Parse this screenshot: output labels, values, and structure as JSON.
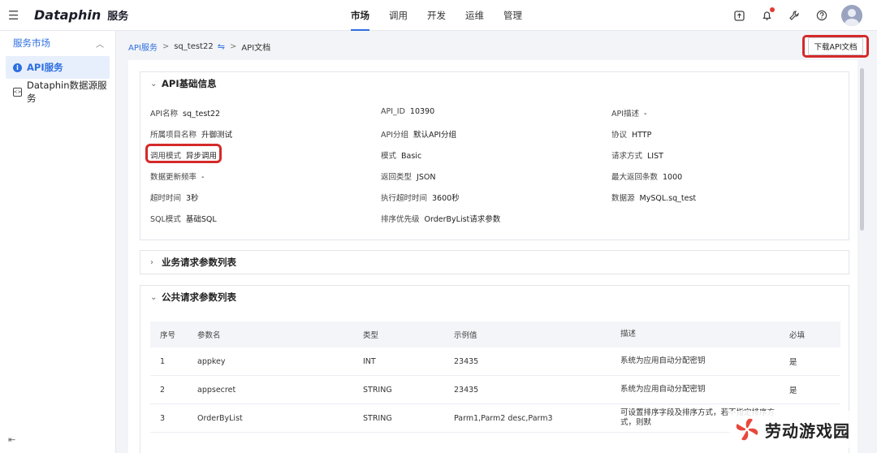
{
  "header": {
    "brand": "Dataphin",
    "brand_suffix": "服务",
    "nav_tabs": [
      {
        "label": "市场",
        "active": true
      },
      {
        "label": "调用",
        "active": false
      },
      {
        "label": "开发",
        "active": false
      },
      {
        "label": "运维",
        "active": false
      },
      {
        "label": "管理",
        "active": false
      }
    ],
    "accent_color": "#2d6fe0"
  },
  "sidebar": {
    "group_label": "服务市场",
    "items": [
      {
        "label": "API服务",
        "active": true,
        "icon": "info-icon"
      },
      {
        "label": "Dataphin数据源服务",
        "active": false,
        "icon": "datasource-icon"
      }
    ]
  },
  "breadcrumb": {
    "root": "API服务",
    "api": "sq_test22",
    "current": "API文档"
  },
  "actions": {
    "download_label": "下载API文档"
  },
  "basic_info": {
    "title": "API基础信息",
    "fields": [
      {
        "key": "API名称",
        "value": "sq_test22"
      },
      {
        "key": "API_ID",
        "value": "10390"
      },
      {
        "key": "API描述",
        "value": "-"
      },
      {
        "key": "所属项目名称",
        "value": "升御测试"
      },
      {
        "key": "API分组",
        "value": "默认API分组"
      },
      {
        "key": "协议",
        "value": "HTTP"
      },
      {
        "key": "调用模式",
        "value": "异步调用"
      },
      {
        "key": "模式",
        "value": "Basic"
      },
      {
        "key": "请求方式",
        "value": "LIST"
      },
      {
        "key": "数据更新频率",
        "value": "-"
      },
      {
        "key": "返回类型",
        "value": "JSON"
      },
      {
        "key": "最大返回条数",
        "value": "1000"
      },
      {
        "key": "超时时间",
        "value": "3秒"
      },
      {
        "key": "执行超时时间",
        "value": "3600秒"
      },
      {
        "key": "数据源",
        "value": "MySQL.sq_test"
      },
      {
        "key": "SQL模式",
        "value": "基础SQL"
      },
      {
        "key": "排序优先级",
        "value": "OrderByList请求参数"
      }
    ]
  },
  "business_params": {
    "title": "业务请求参数列表"
  },
  "public_params": {
    "title": "公共请求参数列表",
    "columns": [
      "序号",
      "参数名",
      "类型",
      "示例值",
      "描述",
      "必填"
    ],
    "rows": [
      [
        "1",
        "appkey",
        "INT",
        "23435",
        "系统为应用自动分配密钥",
        "是"
      ],
      [
        "2",
        "appsecret",
        "STRING",
        "23435",
        "系统为应用自动分配密钥",
        "是"
      ],
      [
        "3",
        "OrderByList",
        "STRING",
        "Parm1,Parm2 desc,Parm3",
        "可设置排序字段及排序方式，若不指定排序方式，则默",
        ""
      ]
    ]
  },
  "watermark": {
    "text": "劳动游戏园"
  }
}
